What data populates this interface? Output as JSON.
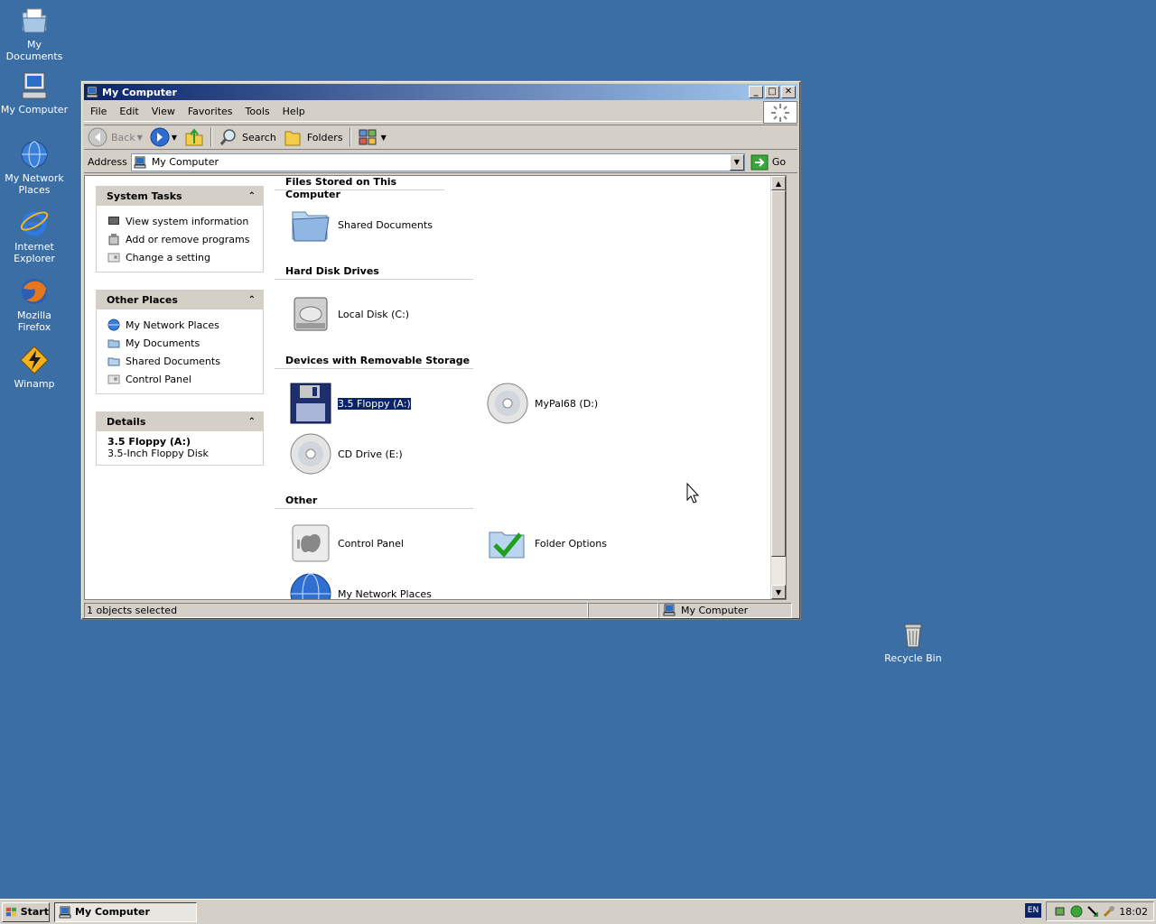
{
  "desktop": {
    "icons": [
      {
        "label": "My Documents"
      },
      {
        "label": "My Computer"
      },
      {
        "label": "My Network Places"
      },
      {
        "label": "Internet Explorer"
      },
      {
        "label": "Mozilla Firefox"
      },
      {
        "label": "Winamp"
      },
      {
        "label": "Recycle Bin"
      }
    ]
  },
  "window": {
    "title": "My Computer",
    "menu": [
      "File",
      "Edit",
      "View",
      "Favorites",
      "Tools",
      "Help"
    ],
    "toolbar": {
      "back_label": "Back",
      "search_label": "Search",
      "folders_label": "Folders"
    },
    "address": {
      "label": "Address",
      "value": "My Computer",
      "go_label": "Go"
    },
    "system_tasks": {
      "title": "System Tasks",
      "items": [
        "View system information",
        "Add or remove programs",
        "Change a setting"
      ]
    },
    "other_places": {
      "title": "Other Places",
      "items": [
        "My Network Places",
        "My Documents",
        "Shared Documents",
        "Control Panel"
      ]
    },
    "details": {
      "title": "Details",
      "name": "3.5 Floppy (A:)",
      "description": "3.5-Inch Floppy Disk"
    },
    "groups": {
      "files": {
        "title": "Files Stored on This Computer",
        "items": [
          "Shared Documents"
        ]
      },
      "hdd": {
        "title": "Hard Disk Drives",
        "items": [
          "Local Disk (C:)"
        ]
      },
      "removable": {
        "title": "Devices with Removable Storage",
        "items": [
          "3.5 Floppy (A:)",
          "MyPal68 (D:)",
          "CD Drive (E:)"
        ]
      },
      "other": {
        "title": "Other",
        "items": [
          "Control Panel",
          "Folder Options",
          "My Network Places"
        ]
      }
    },
    "status": {
      "left": "1 objects selected",
      "right": "My Computer"
    }
  },
  "taskbar": {
    "start_label": "Start",
    "task_label": "My Computer",
    "lang": "EN",
    "clock": "18:02"
  },
  "colors": {
    "desktop": "#3a6ea5",
    "title_start": "#0a246a",
    "title_end": "#a6caf0",
    "selection": "#0a246a"
  }
}
